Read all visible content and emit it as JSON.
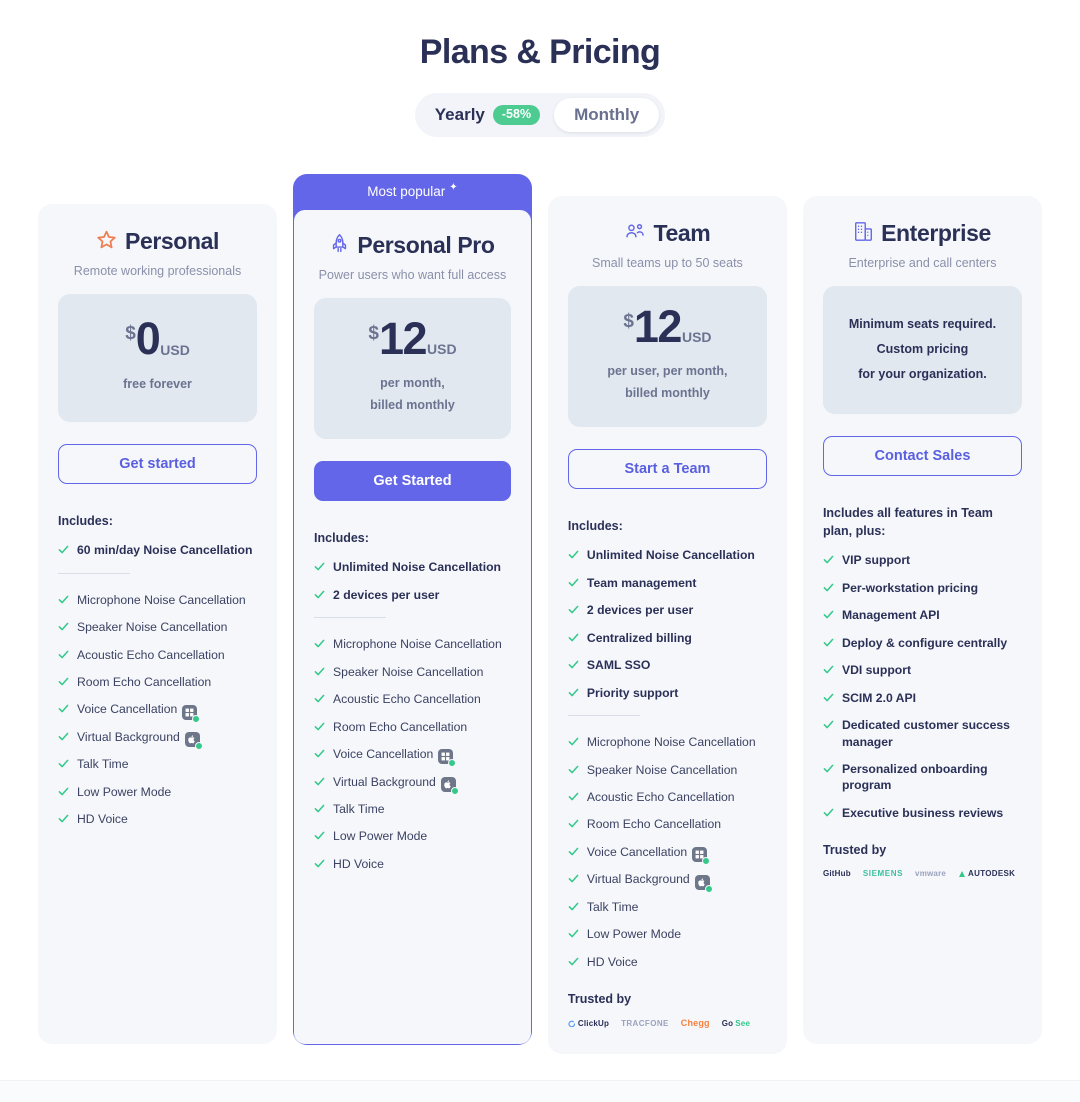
{
  "header": {
    "title": "Plans & Pricing",
    "toggle": {
      "yearly_label": "Yearly",
      "discount_badge": "-58%",
      "monthly_label": "Monthly"
    }
  },
  "plans": [
    {
      "icon": "star-icon",
      "name": "Personal",
      "subtitle": "Remote working professionals",
      "currency": "$",
      "amount": "0",
      "unit": "USD",
      "note": "free forever",
      "cta": "Get started",
      "includes_label": "Includes:",
      "primary_features": [
        "60 min/day Noise Cancellation"
      ],
      "secondary_features": [
        "Microphone Noise Cancellation",
        "Speaker Noise Cancellation",
        "Acoustic Echo Cancellation",
        "Room Echo Cancellation",
        "Voice Cancellation",
        "Virtual Background",
        "Talk Time",
        "Low Power Mode",
        "HD Voice"
      ],
      "badge_rows": [
        "Voice Cancellation",
        "Virtual Background"
      ],
      "trusted_label": "",
      "logos": []
    },
    {
      "banner": "Most popular",
      "icon": "rocket-icon",
      "name": "Personal Pro",
      "subtitle": "Power users who want full access",
      "currency": "$",
      "amount": "12",
      "unit": "USD",
      "note_line1": "per month,",
      "note_line2": "billed monthly",
      "cta": "Get Started",
      "includes_label": "Includes:",
      "primary_features": [
        "Unlimited Noise Cancellation",
        "2 devices per user"
      ],
      "secondary_features": [
        "Microphone Noise Cancellation",
        "Speaker Noise Cancellation",
        "Acoustic Echo Cancellation",
        "Room Echo Cancellation",
        "Voice Cancellation",
        "Virtual Background",
        "Talk Time",
        "Low Power Mode",
        "HD Voice"
      ],
      "badge_rows": [
        "Voice Cancellation",
        "Virtual Background"
      ],
      "trusted_label": "",
      "logos": []
    },
    {
      "icon": "team-icon",
      "name": "Team",
      "subtitle": "Small teams up to 50 seats",
      "currency": "$",
      "amount": "12",
      "unit": "USD",
      "note_line1": "per user, per month,",
      "note_line2": "billed monthly",
      "cta": "Start a Team",
      "includes_label": "Includes:",
      "primary_features": [
        "Unlimited Noise Cancellation",
        "Team management",
        "2 devices per user",
        "Centralized billing",
        "SAML SSO",
        "Priority support"
      ],
      "secondary_features": [
        "Microphone Noise Cancellation",
        "Speaker Noise Cancellation",
        "Acoustic Echo Cancellation",
        "Room Echo Cancellation",
        "Voice Cancellation",
        "Virtual Background",
        "Talk Time",
        "Low Power Mode",
        "HD Voice"
      ],
      "badge_rows": [
        "Voice Cancellation",
        "Virtual Background"
      ],
      "trusted_label": "Trusted by",
      "logos": [
        "ClickUp",
        "TRACFONE",
        "Chegg",
        "GoSee"
      ]
    },
    {
      "icon": "building-icon",
      "name": "Enterprise",
      "subtitle": "Enterprise and call centers",
      "custom_note_line1": "Minimum seats required.",
      "custom_note_line2": "Custom pricing",
      "custom_note_line3": "for your organization.",
      "cta": "Contact Sales",
      "includes_label": "Includes all features in Team plan, plus:",
      "primary_features": [
        "VIP support",
        "Per-workstation pricing",
        "Management API",
        "Deploy & configure centrally",
        "VDI support",
        "SCIM 2.0 API",
        "Dedicated customer success manager",
        "Personalized onboarding program",
        "Executive business reviews"
      ],
      "secondary_features": [],
      "badge_rows": [],
      "trusted_label": "Trusted by",
      "logos": [
        "GitHub",
        "SIEMENS",
        "vmware",
        "AUTODESK"
      ]
    }
  ],
  "colors": {
    "accent": "#6366e8",
    "check_green": "#34c98a",
    "badge_green": "#4dcb91",
    "heading": "#2b3057",
    "card_bg": "#f5f7fb",
    "price_bg": "#e2e8f0",
    "star_orange": "#f07d4f"
  }
}
